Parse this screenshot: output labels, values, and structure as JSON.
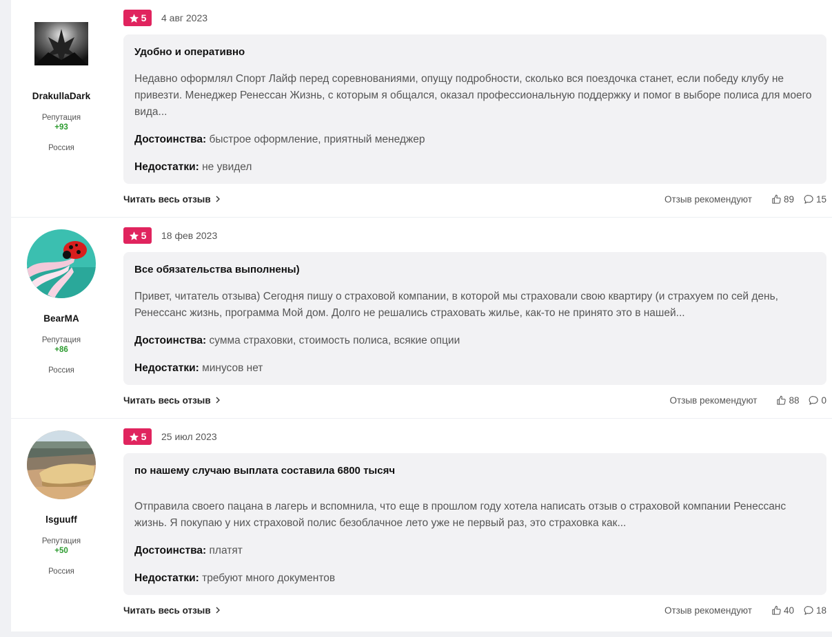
{
  "reviews": [
    {
      "author": "DrakullaDark",
      "reputation_label": "Репутация",
      "reputation": "+93",
      "country": "Россия",
      "rating": "5",
      "date": "4 авг 2023",
      "title": "Удобно и оперативно",
      "text": "Недавно оформлял Спорт Лайф перед соревнованиями, опущу подробности, сколько вся поездочка станет, если победу клубу не привезти. Менеджер Ренессан Жизнь, с которым я общался, оказал профессиональную поддержку и помог в выборе полиса для моего вида...",
      "pros_label": "Достоинства:",
      "pros": "быстрое оформление, приятный менеджер",
      "cons_label": "Недостатки:",
      "cons": "не увидел",
      "read_more": "Читать весь отзыв",
      "recommend_label": "Отзыв рекомендуют",
      "likes": "89",
      "comments": "15"
    },
    {
      "author": "BearMA",
      "reputation_label": "Репутация",
      "reputation": "+86",
      "country": "Россия",
      "rating": "5",
      "date": "18 фев 2023",
      "title": "Все обязательства выполнены)",
      "text": "Привет, читатель отзыва) Сегодня пишу о страховой компании, в которой мы страховали свою квартиру (и страхуем по сей день, Ренессанс жизнь, программа Мой дом. Долго не решались страховать жилье, как-то не принято это в нашей...",
      "pros_label": "Достоинства:",
      "pros": "сумма страховки, стоимость полиса, всякие опции",
      "cons_label": "Недостатки:",
      "cons": "минусов нет",
      "read_more": "Читать весь отзыв",
      "recommend_label": "Отзыв рекомендуют",
      "likes": "88",
      "comments": "0"
    },
    {
      "author": "lsguuff",
      "reputation_label": "Репутация",
      "reputation": "+50",
      "country": "Россия",
      "rating": "5",
      "date": "25 июл 2023",
      "title": "по нашему случаю выплата составила 6800 тысяч",
      "text": "Отправила своего пацана в лагерь и вспомнила, что еще в прошлом году хотела написать отзыв о страховой компании Ренессанс жизнь. Я покупаю у них страховой полис безоблачное лето уже не первый раз, это страховка как...",
      "pros_label": "Достоинства:",
      "pros": "платят",
      "cons_label": "Недостатки:",
      "cons": "требуют много документов",
      "read_more": "Читать весь отзыв",
      "recommend_label": "Отзыв рекомендуют",
      "likes": "40",
      "comments": "18"
    }
  ],
  "colors": {
    "rating_bg": "#e0245e",
    "reputation": "#2c9b2f",
    "card_bg": "#f2f2f4"
  },
  "icons": [
    "star-icon",
    "thumbs-up-icon",
    "comment-icon",
    "chevron-right-icon"
  ]
}
